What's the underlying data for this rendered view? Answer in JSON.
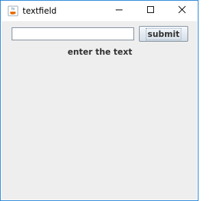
{
  "window": {
    "title": "textfield",
    "icon": "java-cup-icon",
    "controls": {
      "minimize": "minimize-icon",
      "maximize": "maximize-icon",
      "close": "close-icon"
    }
  },
  "form": {
    "text_field_value": "",
    "submit_label": "submit",
    "status_label": "enter the text"
  },
  "colors": {
    "window_border": "#1e7fd6",
    "content_background": "#eeeeee",
    "label_text": "#333333"
  }
}
